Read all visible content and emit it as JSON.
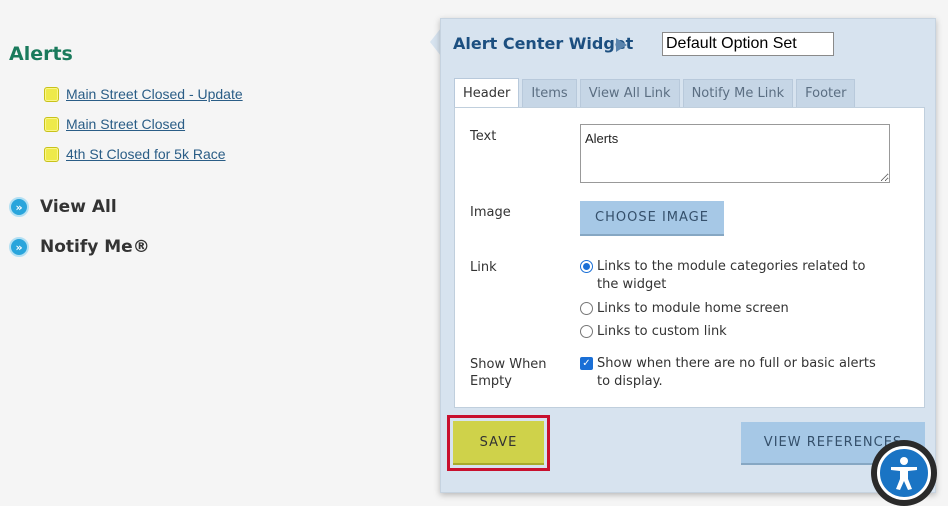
{
  "sidebar": {
    "title": "Alerts",
    "alerts": [
      {
        "label": "Main Street Closed - Update"
      },
      {
        "label": "Main Street Closed"
      },
      {
        "label": "4th St Closed for 5k Race"
      }
    ],
    "view_all": "View All",
    "notify_me": "Notify Me®"
  },
  "panel": {
    "title": "Alert Center Widget",
    "option_set_value": "Default Option Set",
    "tabs": [
      {
        "label": "Header",
        "active": true
      },
      {
        "label": "Items"
      },
      {
        "label": "View All Link"
      },
      {
        "label": "Notify Me Link"
      },
      {
        "label": "Footer"
      }
    ],
    "text_label": "Text",
    "text_value": "Alerts",
    "image_label": "Image",
    "choose_image": "CHOOSE IMAGE",
    "link_label": "Link",
    "link_options": [
      {
        "label": "Links to the module categories related to the widget",
        "selected": true
      },
      {
        "label": "Links to module home screen",
        "selected": false
      },
      {
        "label": "Links to custom link",
        "selected": false
      }
    ],
    "show_when_empty_label": "Show When Empty",
    "show_when_empty_option": "Show when there are no full or basic alerts to display.",
    "show_when_empty_checked": true,
    "save": "SAVE",
    "view_references": "VIEW REFERENCES"
  },
  "colors": {
    "accent_green": "#1a7a5c",
    "link_blue": "#2a5d86",
    "panel_bg": "#d7e3ef",
    "button_blue": "#a6c8e6",
    "save_yellow": "#cfd24a",
    "highlight_red": "#c8102e"
  },
  "icons": {
    "alert_bullet": "yellow-square-icon",
    "view_all": "chevron-circle-icon",
    "notify_me": "chevron-circle-icon",
    "separator": "triangle-right-icon",
    "accessibility": "accessibility-icon"
  }
}
